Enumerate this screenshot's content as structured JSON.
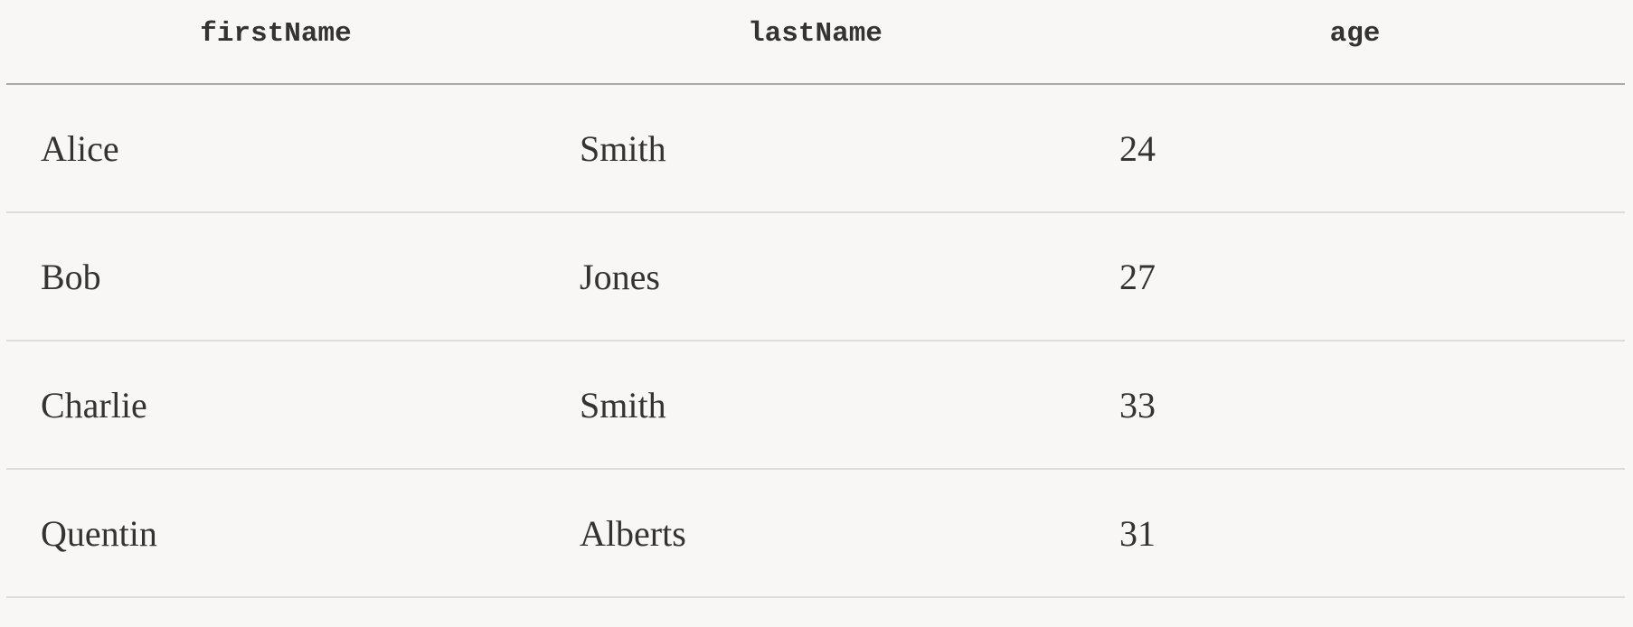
{
  "table": {
    "headers": [
      "firstName",
      "lastName",
      "age"
    ],
    "rows": [
      [
        "Alice",
        "Smith",
        "24"
      ],
      [
        "Bob",
        "Jones",
        "27"
      ],
      [
        "Charlie",
        "Smith",
        "33"
      ],
      [
        "Quentin",
        "Alberts",
        "31"
      ]
    ]
  },
  "colors": {
    "background": "#f8f7f5",
    "text": "#333333",
    "header_rule": "#a9a9a9",
    "row_rule": "#dcdcdc"
  }
}
